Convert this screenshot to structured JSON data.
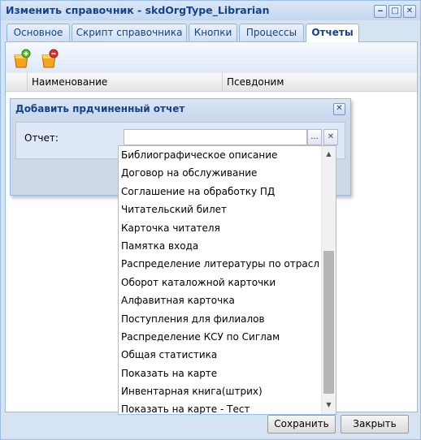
{
  "window": {
    "title": "Изменить справочник - skdOrgType_Librarian",
    "tools": [
      "minimize-icon",
      "maximize-icon",
      "close-icon"
    ]
  },
  "tabs": [
    {
      "label": "Основное",
      "active": false
    },
    {
      "label": "Скрипт справочника",
      "active": false
    },
    {
      "label": "Кнопки",
      "active": false
    },
    {
      "label": "Процессы",
      "active": false
    },
    {
      "label": "Отчеты",
      "active": true
    }
  ],
  "toolbar": {
    "buttons": [
      "add-report-icon",
      "remove-report-icon"
    ]
  },
  "grid": {
    "columns": [
      "Наименование",
      "Псевдоним"
    ]
  },
  "dialog": {
    "title": "Добавить прдчиненный отчет",
    "field_label": "Отчет:",
    "input_value": "",
    "browse_label": "...",
    "clear_label": "✕"
  },
  "dropdown": {
    "items": [
      "Библиографическое описание",
      "Договор на обслуживание",
      "Соглашение на обработку ПД",
      "Читательский билет",
      "Карточка читателя",
      "Памятка входа",
      "Распределение литературы по отрасл...",
      "Оборот каталожной карточки",
      "Алфавитная карточка",
      "Поступления для филиалов",
      "Распределение КСУ по Сиглам",
      "Общая статистика",
      "Показать на карте",
      "Инвентарная книга(штрих)",
      "Показать на карте - Тест"
    ]
  },
  "footer": {
    "save_label": "Сохранить",
    "close_label": "Закрыть"
  },
  "colors": {
    "accent": "#15428b",
    "border": "#99bbe8",
    "background": "#d6e3f2"
  }
}
